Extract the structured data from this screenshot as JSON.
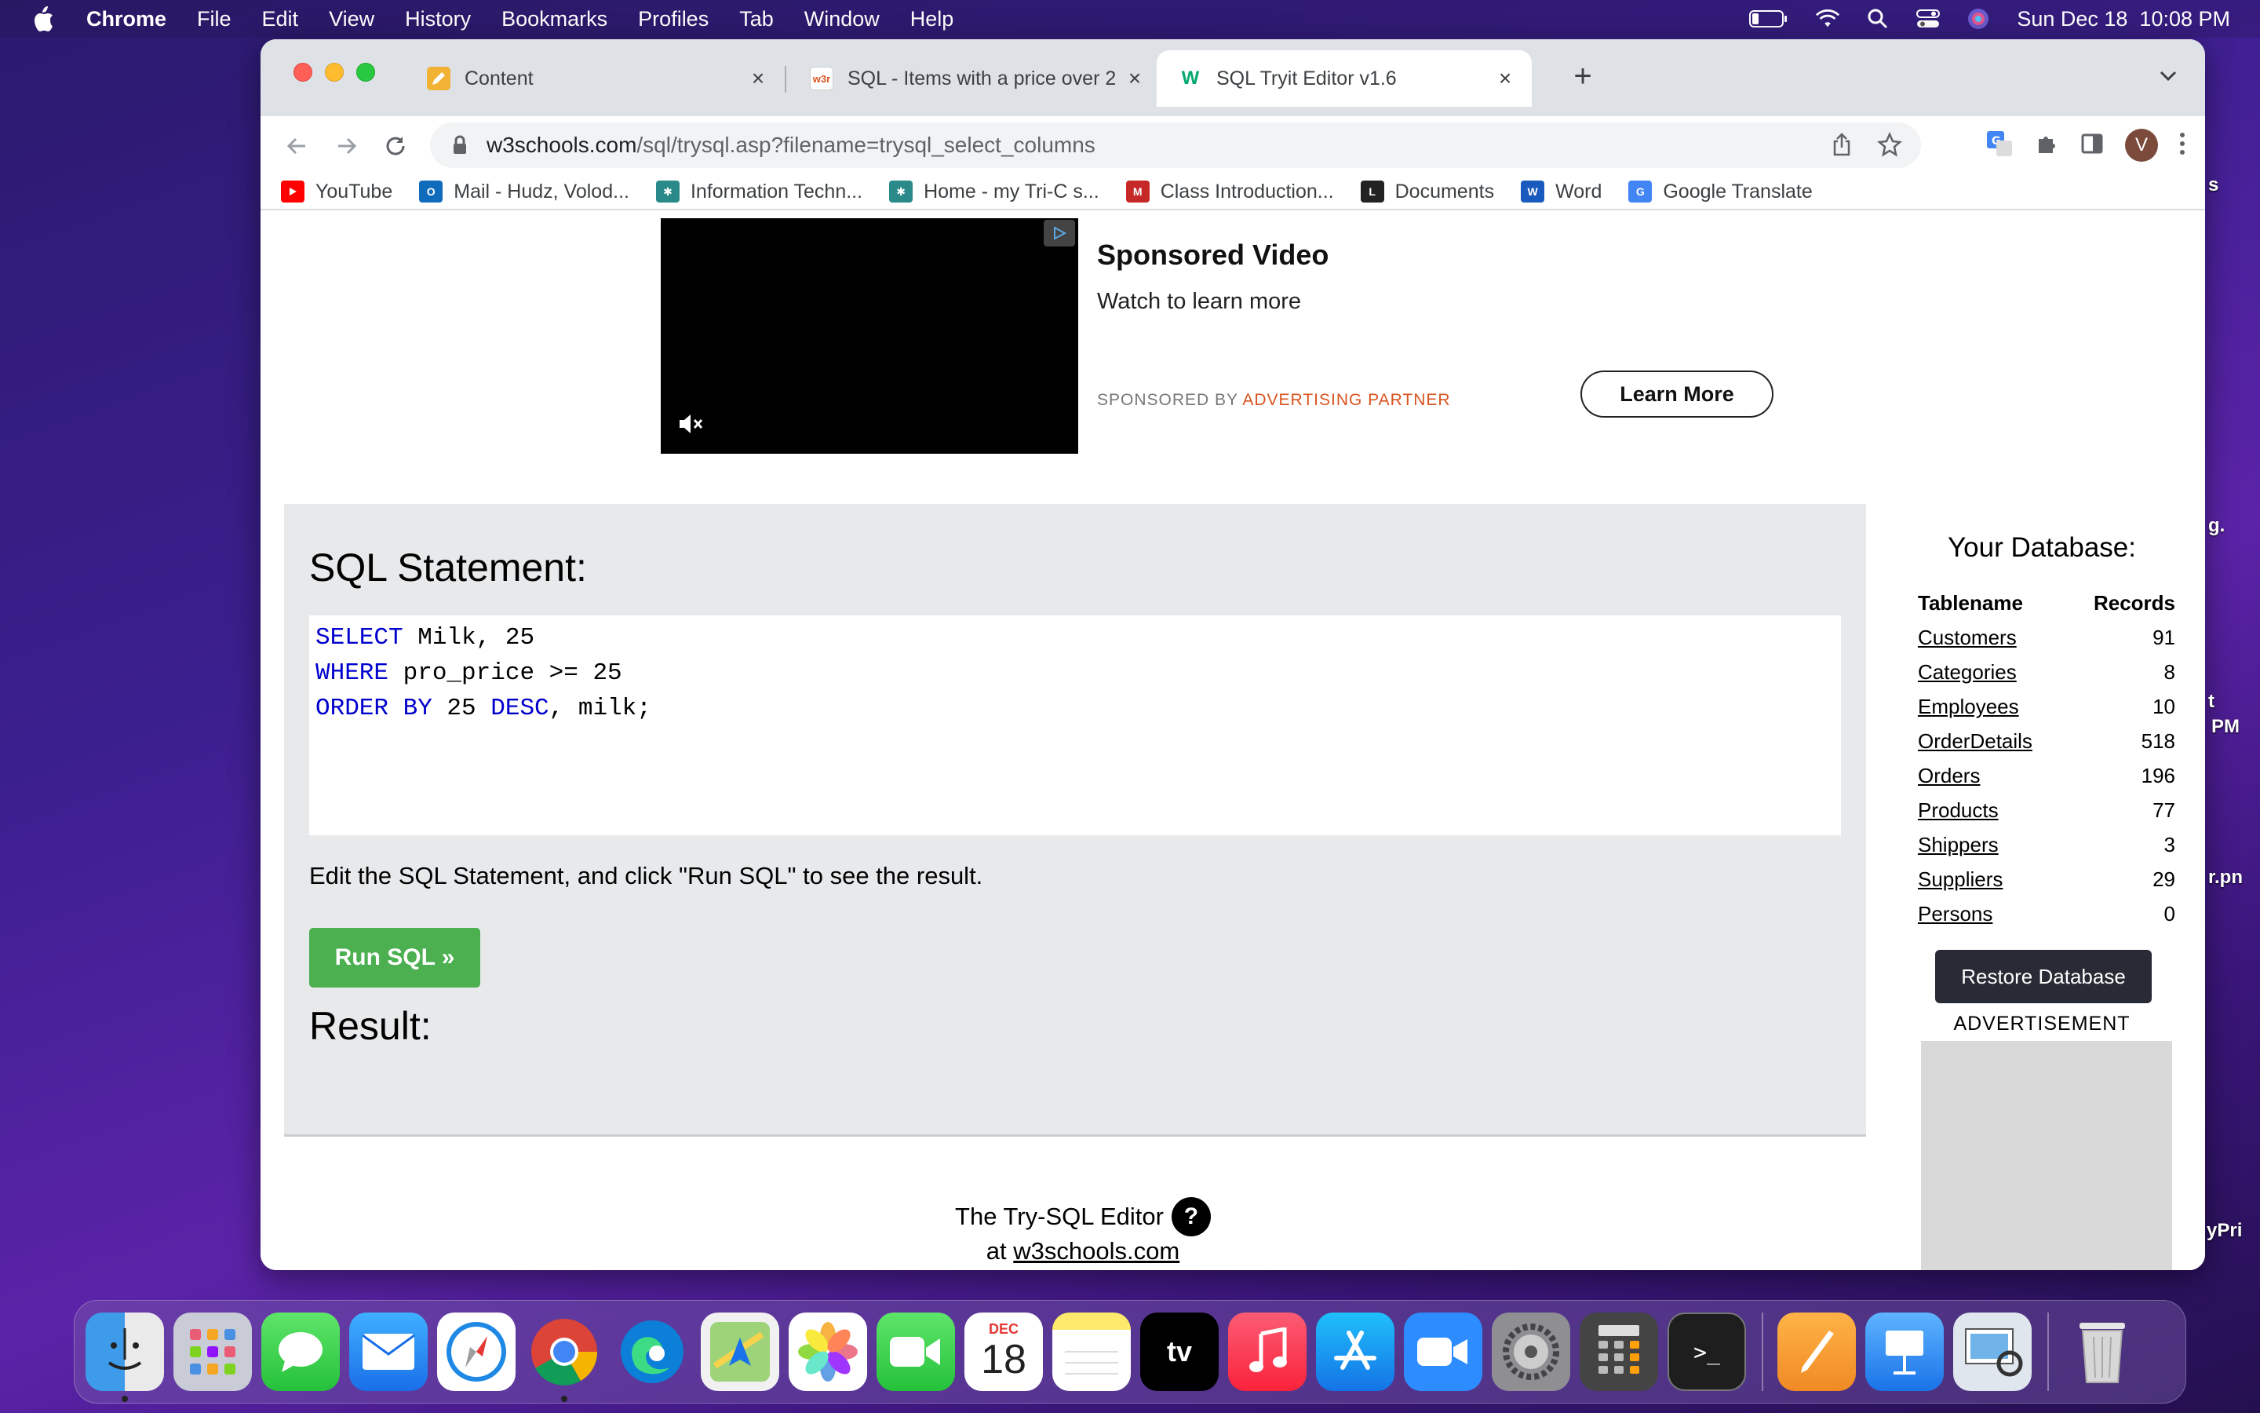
{
  "menubar": {
    "app": "Chrome",
    "items": [
      "File",
      "Edit",
      "View",
      "History",
      "Bookmarks",
      "Profiles",
      "Tab",
      "Window",
      "Help"
    ],
    "datetime": "Sun Dec 18  10:08 PM"
  },
  "tabs": [
    {
      "title": "Content",
      "favicon": "pencil-icon"
    },
    {
      "title": "SQL - Items with a price over 2",
      "favicon": "w3r-icon"
    },
    {
      "title": "SQL Tryit Editor v1.6",
      "favicon": "w3schools-icon",
      "active": true
    }
  ],
  "omnibox": {
    "host": "w3schools.com",
    "path": "/sql/trysql.asp?filename=trysql_select_columns"
  },
  "profile_initial": "V",
  "bookmarks": [
    {
      "label": "YouTube",
      "color": "#ff0000"
    },
    {
      "label": "Mail - Hudz, Volod...",
      "color": "#0f6cbd"
    },
    {
      "label": "Information Techn...",
      "color": "#2a8a8a"
    },
    {
      "label": "Home - my Tri-C s...",
      "color": "#2a8a8a"
    },
    {
      "label": "Class Introduction...",
      "color": "#c62828"
    },
    {
      "label": "Documents",
      "color": "#222222"
    },
    {
      "label": "Word",
      "color": "#185abd"
    },
    {
      "label": "Google Translate",
      "color": "#4285f4"
    }
  ],
  "ad": {
    "title": "Sponsored Video",
    "subtitle": "Watch to learn more",
    "sponsored_by": "SPONSORED BY",
    "partner": "ADVERTISING PARTNER",
    "cta": "Learn More"
  },
  "editor": {
    "heading": "SQL Statement:",
    "code_lines": [
      {
        "kw": "SELECT",
        "rest": " Milk, 25"
      },
      {
        "kw": "WHERE",
        "rest": " pro_price >= 25"
      },
      {
        "kw": "ORDER BY",
        "rest": " 25 ",
        "kw2": "DESC",
        "rest2": ", milk;"
      }
    ],
    "hint": "Edit the SQL Statement, and click \"Run SQL\" to see the result.",
    "run_label": "Run SQL »",
    "result_heading": "Result:"
  },
  "database": {
    "title": "Your Database:",
    "col_table": "Tablename",
    "col_records": "Records",
    "rows": [
      {
        "name": "Customers",
        "records": "91"
      },
      {
        "name": "Categories",
        "records": "8"
      },
      {
        "name": "Employees",
        "records": "10"
      },
      {
        "name": "OrderDetails",
        "records": "518"
      },
      {
        "name": "Orders",
        "records": "196"
      },
      {
        "name": "Products",
        "records": "77"
      },
      {
        "name": "Shippers",
        "records": "3"
      },
      {
        "name": "Suppliers",
        "records": "29"
      },
      {
        "name": "Persons",
        "records": "0"
      }
    ],
    "restore_label": "Restore Database",
    "ad_label": "ADVERTISEMENT"
  },
  "footer": {
    "line1": "The Try-SQL Editor",
    "line2_prefix": "at",
    "line2_link": "w3schools.com"
  },
  "desktop_fragments": [
    "s",
    "g.",
    "t",
    "PM",
    "r.pn",
    "yPri"
  ],
  "dock": {
    "calendar_month": "DEC",
    "calendar_day": "18"
  }
}
